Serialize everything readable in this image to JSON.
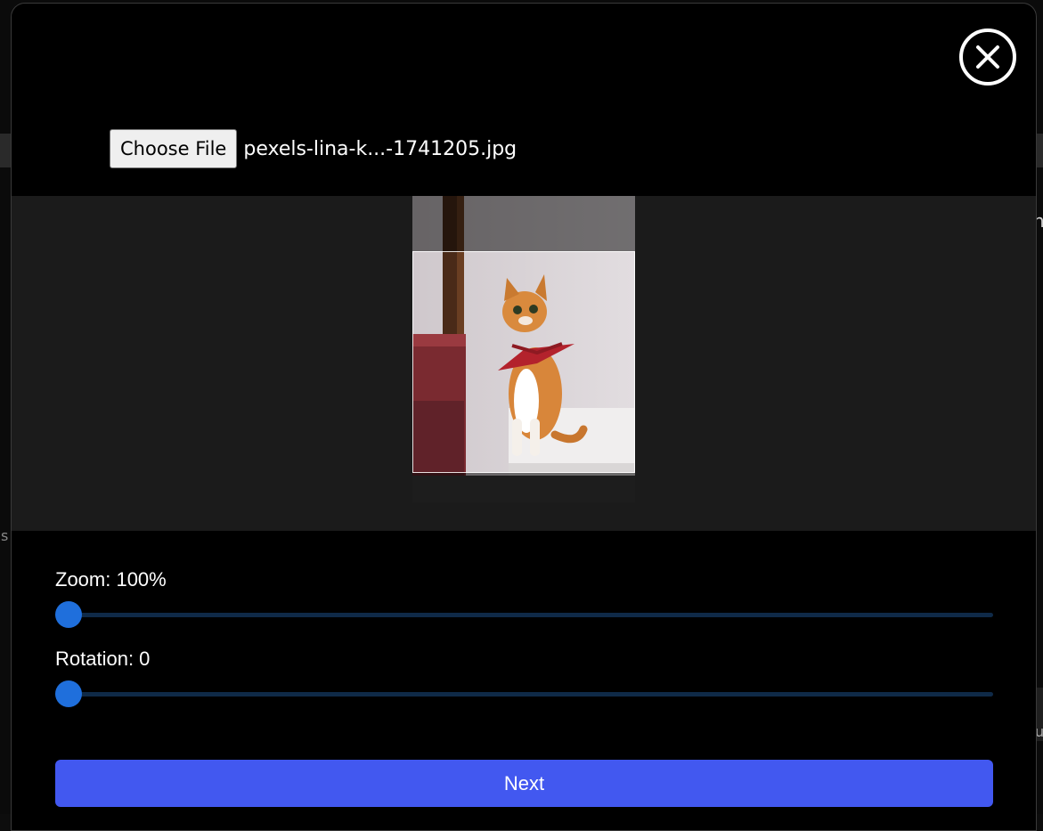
{
  "background": {
    "right_glyph_1": "n",
    "left_glyph": "s",
    "right_glyph_2": "u"
  },
  "modal": {
    "close_icon": "close-circle-icon",
    "file_input": {
      "button_label": "Choose File",
      "file_name": "pexels-lina-k...-1741205.jpg"
    },
    "cropper": {
      "image_subject": "orange-cat-with-red-bandana"
    },
    "zoom": {
      "label": "Zoom: 100%",
      "value_percent": 100,
      "slider_fraction": 0
    },
    "rotation": {
      "label": "Rotation: 0",
      "value": 0,
      "slider_fraction": 0
    },
    "next_label": "Next"
  },
  "colors": {
    "accent": "#4258f0",
    "slider_thumb": "#1f6fdc",
    "slider_track": "#0f2a48",
    "modal_bg": "#000000",
    "crop_area_bg": "#1b1b1b"
  }
}
